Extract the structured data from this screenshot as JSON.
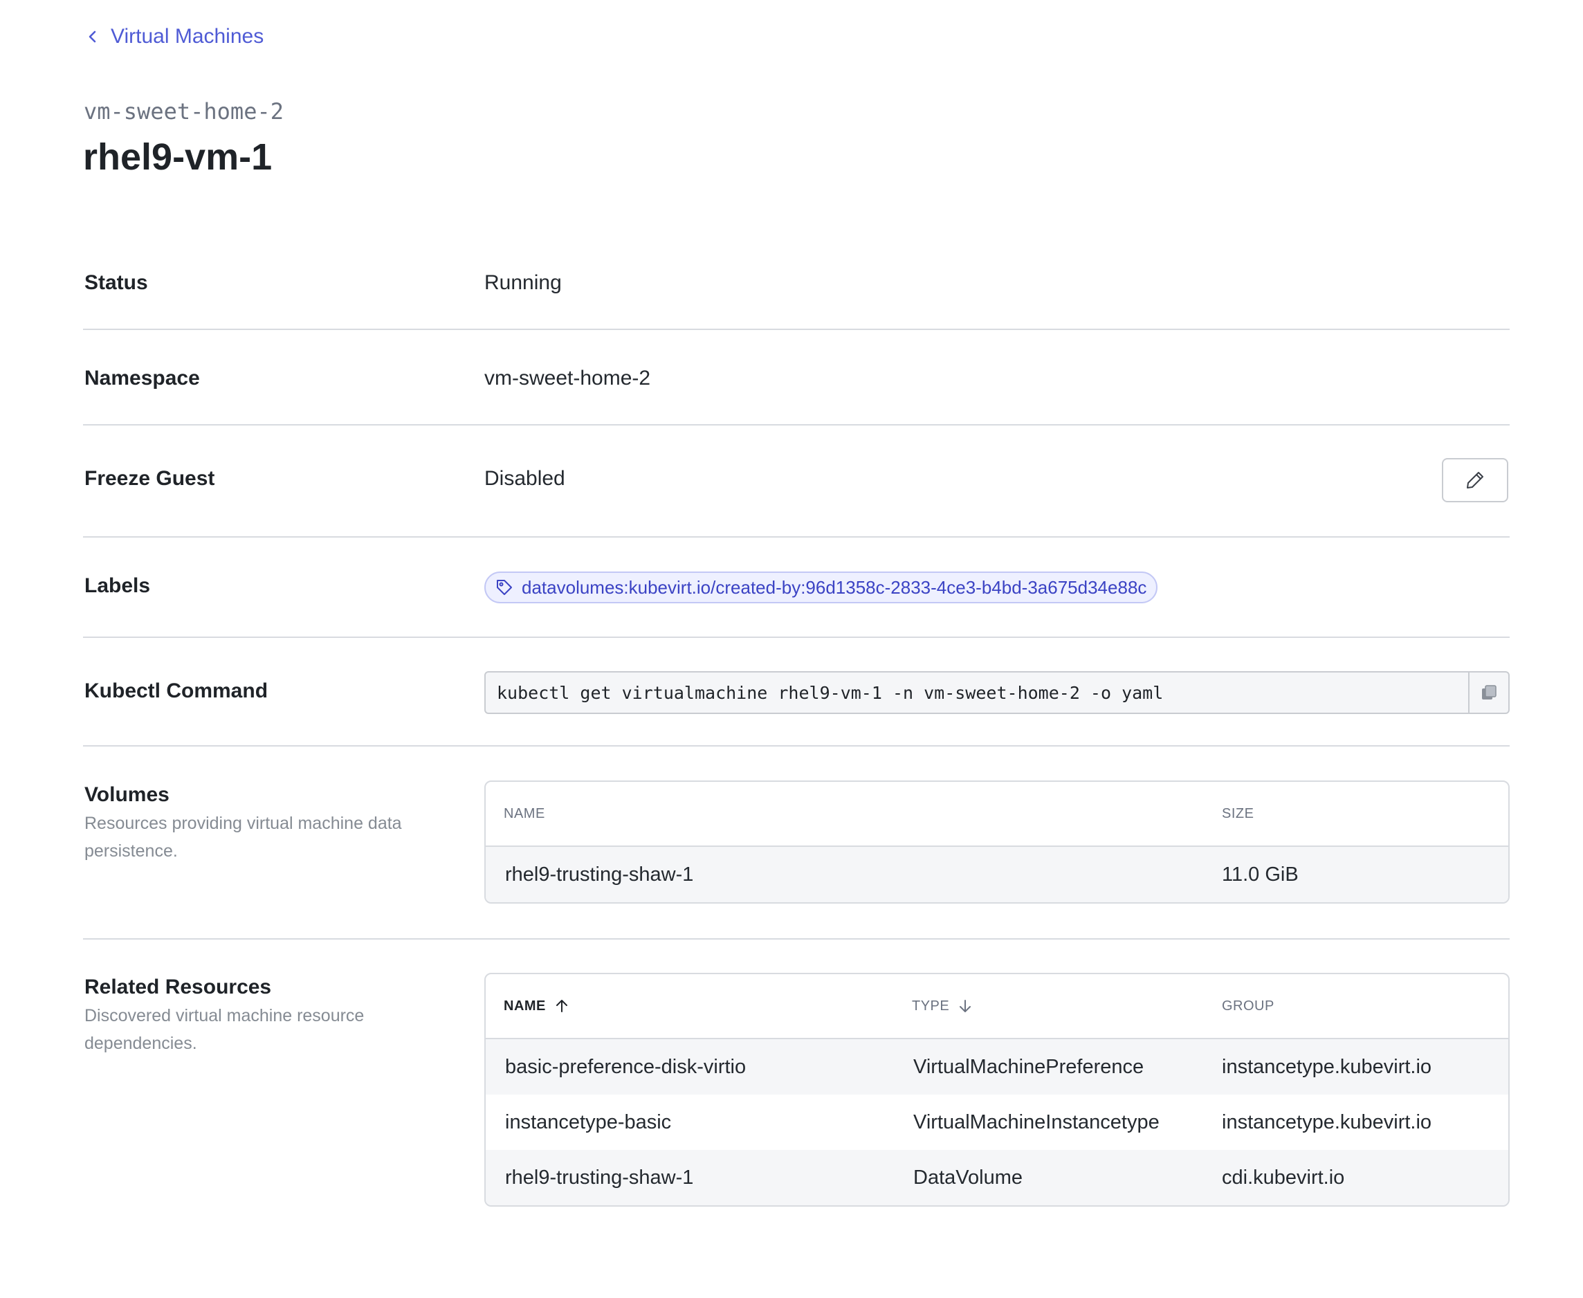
{
  "nav": {
    "back_label": "Virtual Machines"
  },
  "header": {
    "namespace": "vm-sweet-home-2",
    "title": "rhel9-vm-1"
  },
  "details": {
    "status": {
      "label": "Status",
      "value": "Running"
    },
    "namespace": {
      "label": "Namespace",
      "value": "vm-sweet-home-2"
    },
    "freeze_guest": {
      "label": "Freeze Guest",
      "value": "Disabled"
    },
    "labels": {
      "label": "Labels",
      "items": [
        "datavolumes:kubevirt.io/created-by:96d1358c-2833-4ce3-b4bd-3a675d34e88c"
      ]
    },
    "kubectl": {
      "label": "Kubectl Command",
      "command": "kubectl get virtualmachine rhel9-vm-1 -n vm-sweet-home-2 -o yaml"
    }
  },
  "volumes": {
    "title": "Volumes",
    "description": "Resources providing virtual machine data persistence.",
    "columns": [
      "NAME",
      "SIZE"
    ],
    "rows": [
      [
        "rhel9-trusting-shaw-1",
        "11.0 GiB"
      ]
    ]
  },
  "related": {
    "title": "Related Resources",
    "description": "Discovered virtual machine resource dependencies.",
    "columns": [
      "NAME",
      "TYPE",
      "GROUP"
    ],
    "sort": {
      "active_column": "NAME",
      "direction": "ascending"
    },
    "rows": [
      [
        "basic-preference-disk-virtio",
        "VirtualMachinePreference",
        "instancetype.kubevirt.io"
      ],
      [
        "instancetype-basic",
        "VirtualMachineInstancetype",
        "instancetype.kubevirt.io"
      ],
      [
        "rhel9-trusting-shaw-1",
        "DataVolume",
        "cdi.kubevirt.io"
      ]
    ]
  },
  "colors": {
    "accent": "#4f5bd5",
    "chip_bg": "#eef0ff",
    "chip_text": "#3b43c4",
    "divider": "#d8dbe0"
  }
}
